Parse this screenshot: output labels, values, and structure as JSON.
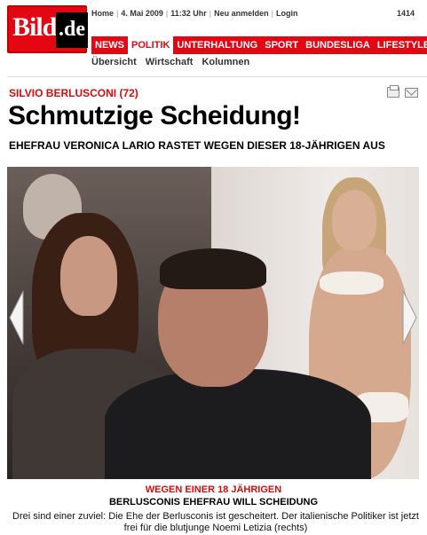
{
  "logo": {
    "part1": "Bild",
    "part2": ".de"
  },
  "topbar": {
    "items": [
      "Home",
      "4. Mai 2009",
      "11:32 Uhr",
      "Neu anmelden",
      "Login"
    ],
    "counter": "1414"
  },
  "nav": {
    "items": [
      "NEWS",
      "POLITIK",
      "UNTERHALTUNG",
      "SPORT",
      "BUNDESLIGA",
      "LIFESTYLE"
    ],
    "active": "POLITIK"
  },
  "subnav": {
    "items": [
      "Übersicht",
      "Wirtschaft",
      "Kolumnen"
    ]
  },
  "article": {
    "kicker": "SILVIO BERLUSCONI (72)",
    "headline": "Schmutzige Scheidung!",
    "subhead": "EHEFRAU VERONICA LARIO RASTET WEGEN DIESER 18-JÄHRIGEN AUS"
  },
  "icons": {
    "print": "print-icon",
    "mail": "mail-icon",
    "prev": "chevron-left-icon",
    "next": "chevron-right-icon"
  },
  "caption": {
    "kicker": "WEGEN EINER 18 JÄHRIGEN",
    "headline": "BERLUSCONIS EHEFRAU WILL SCHEIDUNG",
    "text": "Drei sind einer zuviel: Die Ehe der Berlusconis ist gescheitert. Der italienische Politiker ist jetzt frei für die blutjunge Noemi Letizia (rechts)"
  },
  "colors": {
    "brand_red": "#e30613",
    "kicker_red": "#d50d0d"
  }
}
